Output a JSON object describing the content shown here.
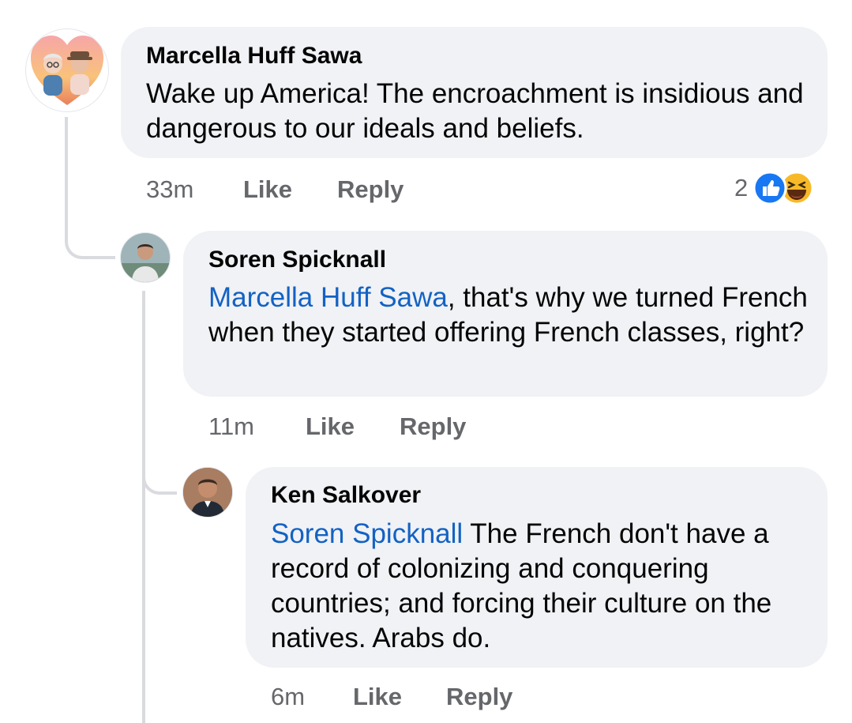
{
  "comments": [
    {
      "author": "Marcella Huff Sawa",
      "text": "Wake up America! The encroachment is insidious and dangerous to our ideals and beliefs.",
      "time": "33m",
      "like_label": "Like",
      "reply_label": "Reply",
      "reaction_count": "2",
      "reactions": [
        "like-icon",
        "haha-icon"
      ]
    },
    {
      "author": "Soren Spicknall",
      "mention": "Marcella Huff Sawa",
      "text": ", that's why we turned French when they started offering French classes, right?",
      "time": "11m",
      "like_label": "Like",
      "reply_label": "Reply"
    },
    {
      "author": "Ken Salkover",
      "mention": "Soren Spicknall",
      "text": " The French don't have a record of colonizing and conquering countries; and forcing their culture on the natives. Arabs do.",
      "time": "6m",
      "like_label": "Like",
      "reply_label": "Reply"
    }
  ],
  "colors": {
    "bubble": "#f0f2f5",
    "mention": "#1362c4",
    "meta": "#65676b",
    "like_blue": "#1877f2",
    "haha_yellow": "#f7b928"
  }
}
